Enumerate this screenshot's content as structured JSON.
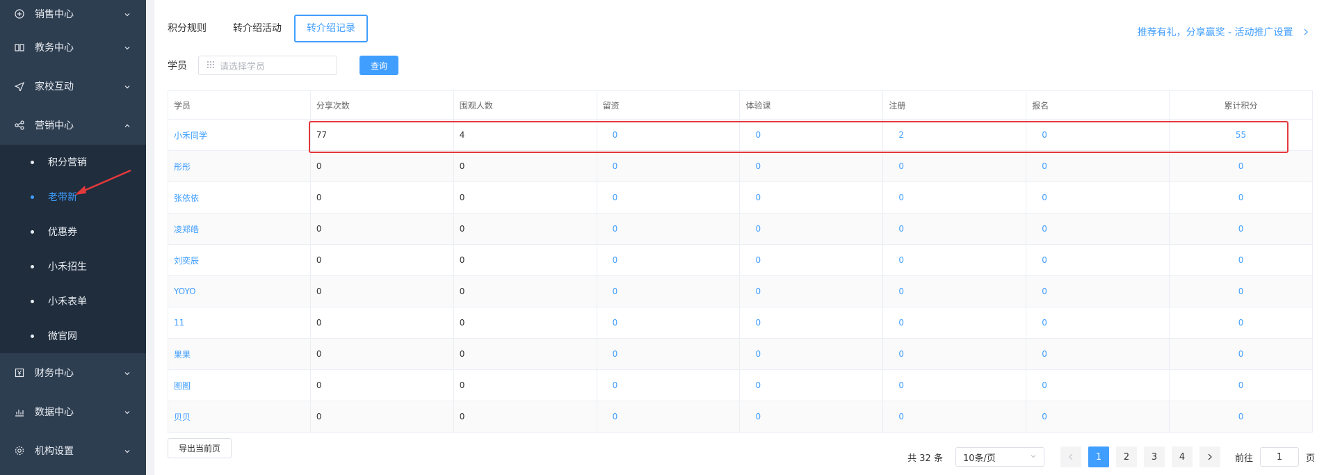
{
  "sidebar": {
    "items": [
      {
        "label": "销售中心",
        "icon": "sales-icon",
        "expanded": false
      },
      {
        "label": "教务中心",
        "icon": "book-icon",
        "expanded": false
      },
      {
        "label": "家校互动",
        "icon": "send-icon",
        "expanded": false
      },
      {
        "label": "营销中心",
        "icon": "share-icon",
        "expanded": true
      },
      {
        "label": "财务中心",
        "icon": "finance-icon",
        "expanded": false
      },
      {
        "label": "数据中心",
        "icon": "chart-icon",
        "expanded": false
      },
      {
        "label": "机构设置",
        "icon": "gear-icon",
        "expanded": false
      }
    ],
    "submenu": [
      "积分营销",
      "老带新",
      "优惠券",
      "小禾招生",
      "小禾表单",
      "微官网"
    ],
    "active_submenu": "老带新"
  },
  "tabs": [
    {
      "label": "积分规则",
      "active": false
    },
    {
      "label": "转介绍活动",
      "active": false
    },
    {
      "label": "转介绍记录",
      "active": true
    }
  ],
  "promo_link": "推荐有礼，分享赢奖 - 活动推广设置",
  "filter": {
    "label": "学员",
    "placeholder": "请选择学员",
    "query_button": "查询"
  },
  "table": {
    "headers": [
      "学员",
      "分享次数",
      "围观人数",
      "留资",
      "体验课",
      "注册",
      "报名",
      "累计积分"
    ],
    "rows": [
      [
        "小禾同学",
        "77",
        "4",
        "0",
        "0",
        "2",
        "0",
        "55"
      ],
      [
        "彤彤",
        "0",
        "0",
        "0",
        "0",
        "0",
        "0",
        "0"
      ],
      [
        "张依依",
        "0",
        "0",
        "0",
        "0",
        "0",
        "0",
        "0"
      ],
      [
        "凌郑皓",
        "0",
        "0",
        "0",
        "0",
        "0",
        "0",
        "0"
      ],
      [
        "刘奕辰",
        "0",
        "0",
        "0",
        "0",
        "0",
        "0",
        "0"
      ],
      [
        "YOYO",
        "0",
        "0",
        "0",
        "0",
        "0",
        "0",
        "0"
      ],
      [
        "11",
        "0",
        "0",
        "0",
        "0",
        "0",
        "0",
        "0"
      ],
      [
        "果果",
        "0",
        "0",
        "0",
        "0",
        "0",
        "0",
        "0"
      ],
      [
        "图图",
        "0",
        "0",
        "0",
        "0",
        "0",
        "0",
        "0"
      ],
      [
        "贝贝",
        "0",
        "0",
        "0",
        "0",
        "0",
        "0",
        "0"
      ]
    ]
  },
  "footer": {
    "export_button": "导出当前页",
    "total": "共 32 条",
    "page_size": "10条/页",
    "pages": [
      "1",
      "2",
      "3",
      "4"
    ],
    "current_page": "1",
    "goto_label": "前往",
    "goto_value": "1",
    "goto_suffix": "页"
  },
  "colors": {
    "sidebar_bg": "#2e3e51",
    "submenu_bg": "#1f2d3d",
    "accent": "#409eff",
    "highlight": "#e4393c"
  }
}
